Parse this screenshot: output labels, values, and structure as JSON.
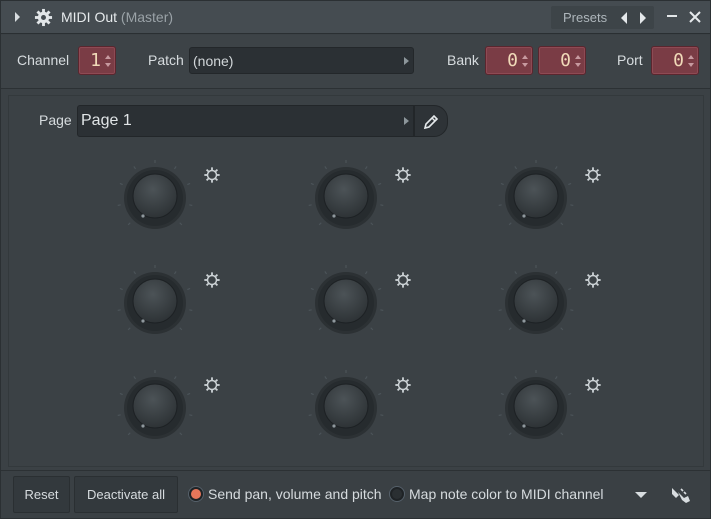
{
  "title": {
    "name": "MIDI Out",
    "suffix": "(Master)"
  },
  "presets": {
    "label": "Presets"
  },
  "channel": {
    "label": "Channel",
    "value": "1"
  },
  "patch": {
    "label": "Patch",
    "value": "(none)"
  },
  "bank": {
    "label": "Bank",
    "value1": "0",
    "value2": "0"
  },
  "port": {
    "label": "Port",
    "value": "0"
  },
  "page": {
    "label": "Page",
    "value": "Page 1"
  },
  "knobs": {
    "count": 9
  },
  "bottom": {
    "reset": "Reset",
    "deactivate_all": "Deactivate all",
    "send_pan": "Send pan, volume and pitch",
    "map_note": "Map note color to MIDI channel"
  },
  "state": {
    "send_pan_on": true,
    "map_note_on": false
  },
  "colors": {
    "spin_bg": "#7a3c45",
    "spin_text": "#f0d9b8",
    "radio_on": "#e8765a"
  }
}
